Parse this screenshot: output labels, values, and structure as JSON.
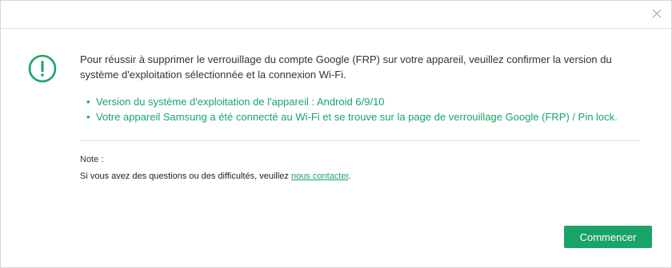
{
  "dialog": {
    "close_icon": "close-icon",
    "alert_icon": "exclamation-circle-icon",
    "accent_color": "#1aa466"
  },
  "message": {
    "line1": "Pour réussir à supprimer le verrouillage du compte Google (FRP) sur votre appareil, veuillez confirmer la version du",
    "line2": "système d'exploitation sélectionnée et la connexion Wi-Fi."
  },
  "checklist": [
    {
      "text": "Version du système d'exploitation de l'appareil : Android 6/9/10"
    },
    {
      "text": "Votre appareil Samsung a été connecté au Wi-Fi et se trouve sur la page de verrouillage Google (FRP) / Pin lock."
    }
  ],
  "note": {
    "label": "Note :",
    "text_before": "Si vous avez des questions ou des difficultés, veuillez ",
    "link": "nous contacter",
    "text_after": "."
  },
  "footer": {
    "start_label": "Commencer"
  }
}
